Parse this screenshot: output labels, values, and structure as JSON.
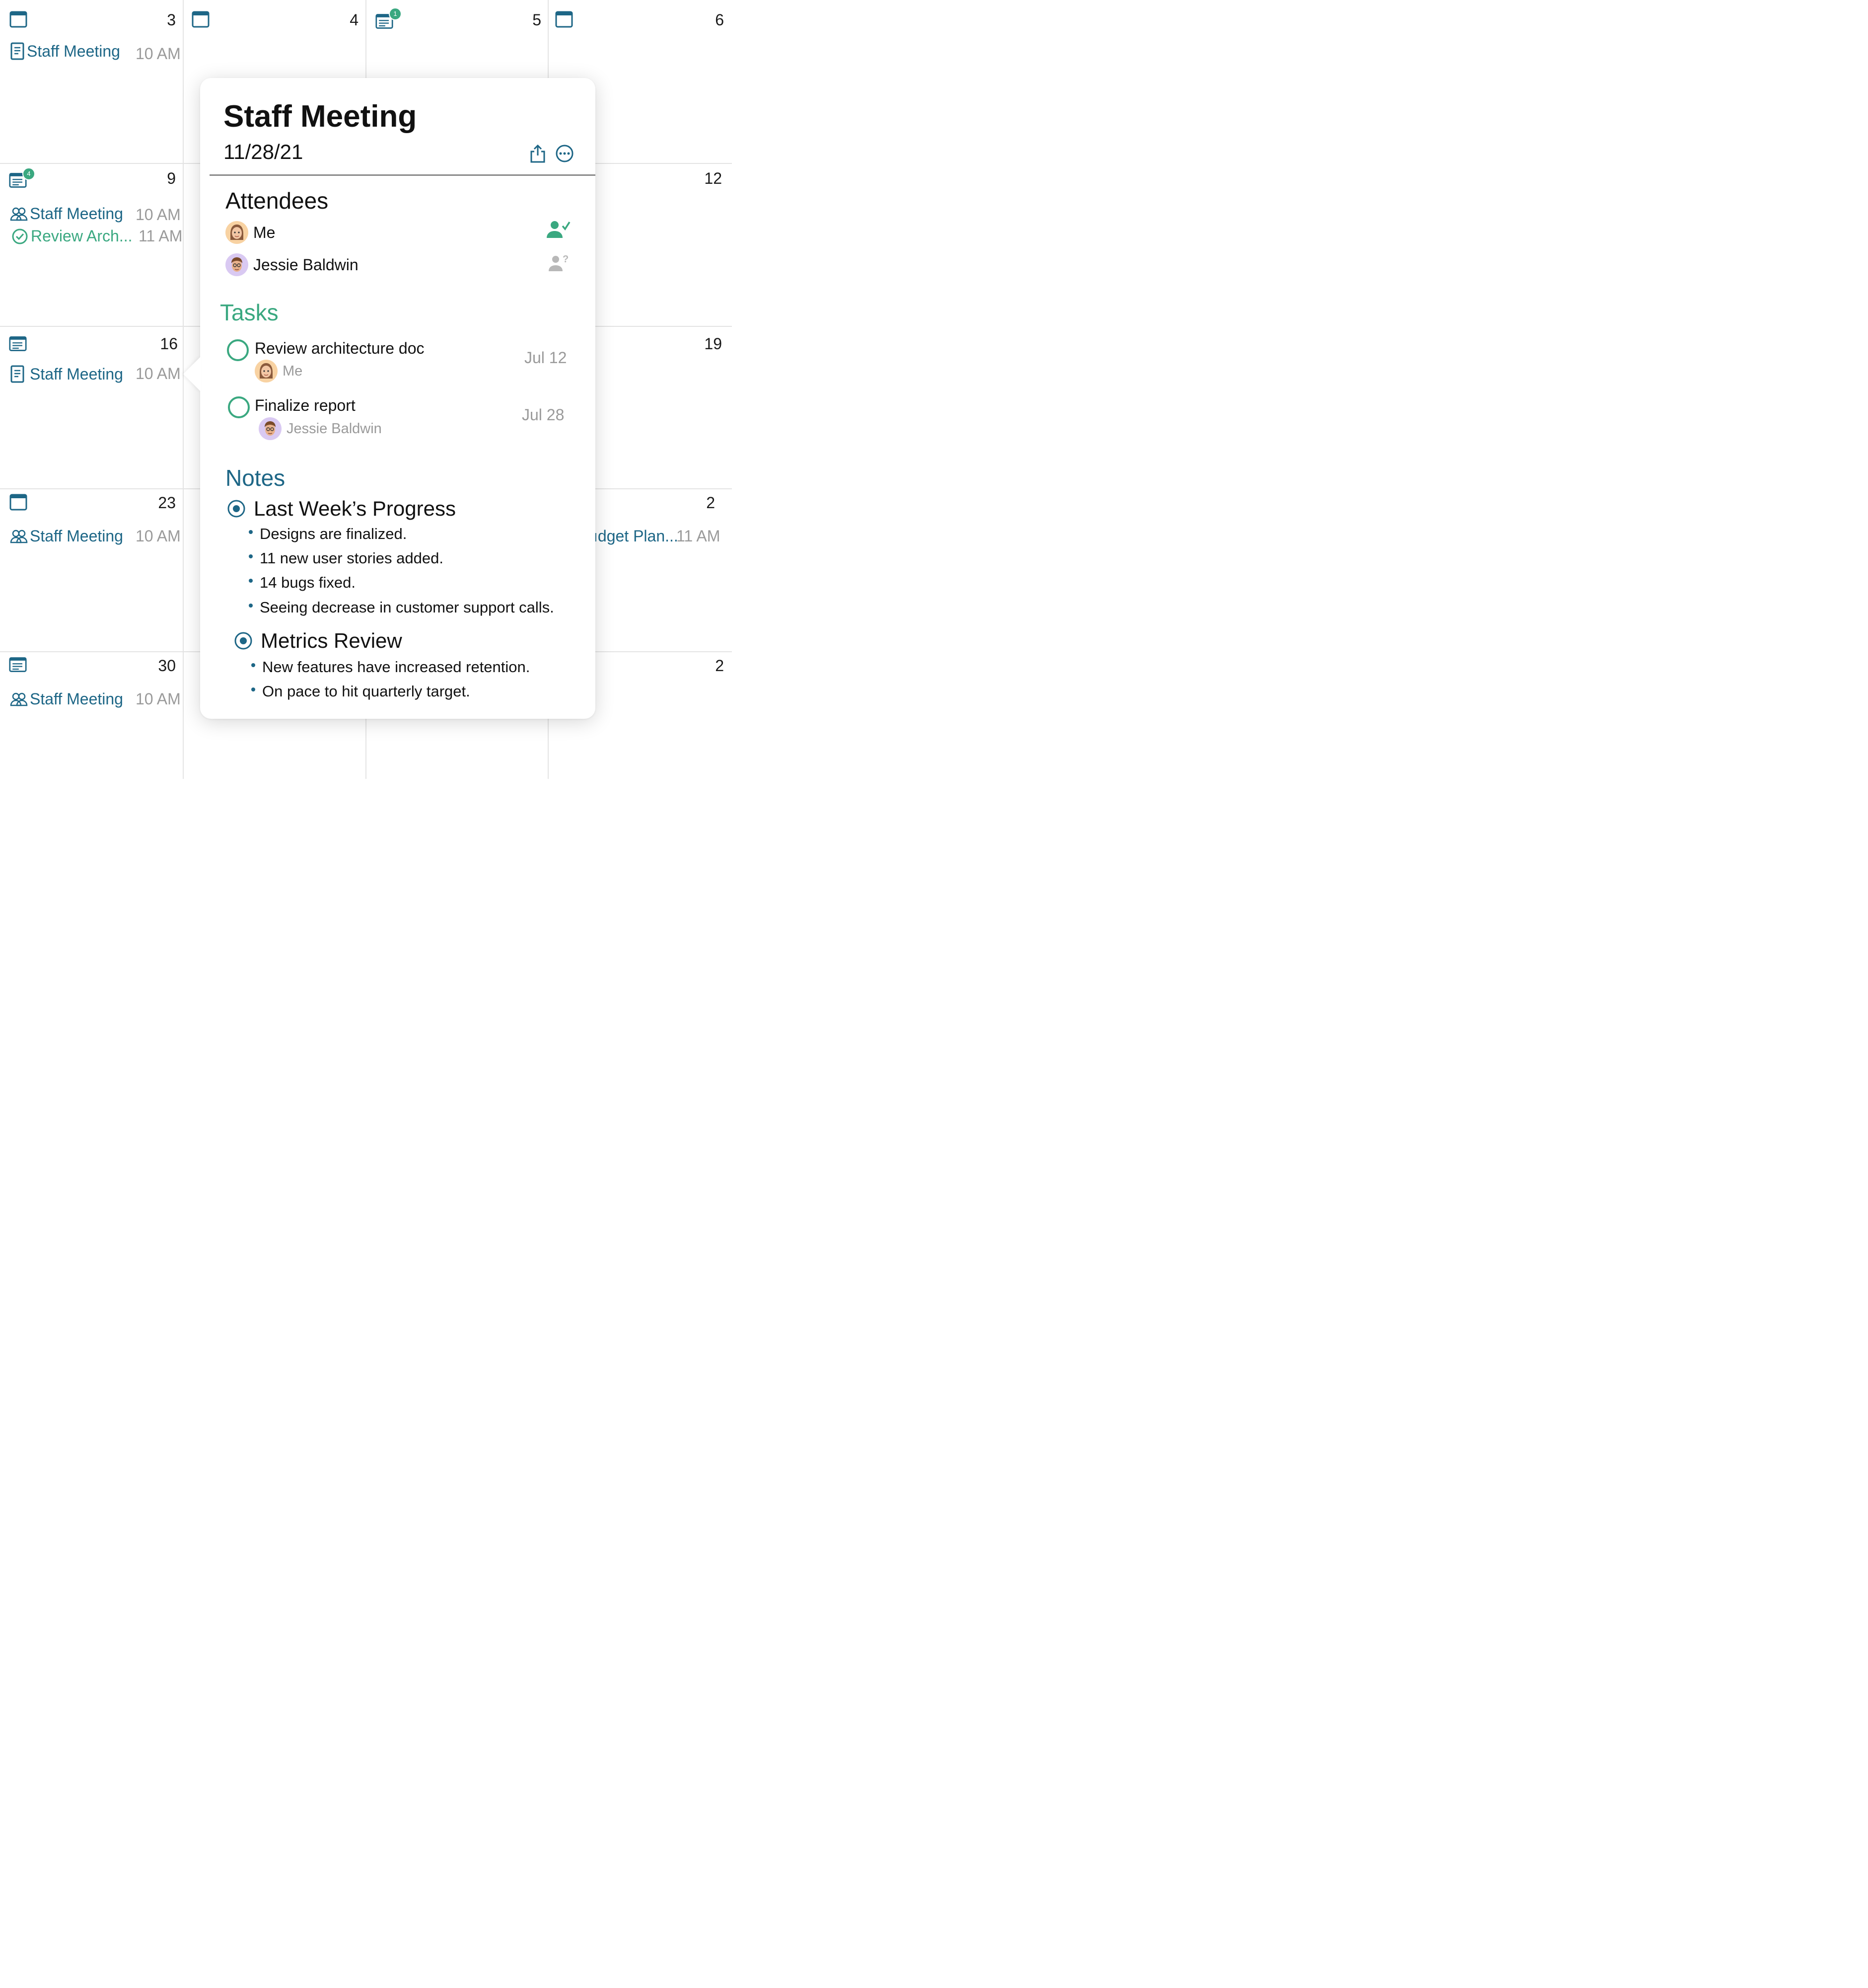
{
  "calendar": {
    "days": {
      "d3": "3",
      "d4": "4",
      "d5": "5",
      "d6": "6",
      "d9": "9",
      "d12": "12",
      "d16": "16",
      "d19": "19",
      "d23": "23",
      "d2a": "2",
      "d30": "30",
      "d2b": "2"
    },
    "badges": {
      "day5": "1",
      "day9": "4"
    },
    "events": {
      "e3": {
        "title": "Staff Meeting",
        "time": "10 AM"
      },
      "e9a": {
        "title": "Staff Meeting",
        "time": "10 AM"
      },
      "e9b": {
        "title": "Review Arch...",
        "time": "11 AM"
      },
      "e16": {
        "title": "Staff Meeting",
        "time": "10 AM"
      },
      "e23": {
        "title": "Staff Meeting",
        "time": "10 AM"
      },
      "e30": {
        "title": "Staff Meeting",
        "time": "10 AM"
      },
      "e2": {
        "title": "ıdget Plan...",
        "time": "11 AM"
      }
    }
  },
  "popover": {
    "title": "Staff Meeting",
    "date": "11/28/21",
    "attendees_heading": "Attendees",
    "attendees": [
      {
        "name": "Me",
        "status": "accepted",
        "avatar": "memoji-woman"
      },
      {
        "name": "Jessie Baldwin",
        "status": "pending",
        "avatar": "memoji-man"
      }
    ],
    "tasks_heading": "Tasks",
    "tasks": [
      {
        "title": "Review architecture doc",
        "assignee": "Me",
        "due": "Jul 12"
      },
      {
        "title": "Finalize report",
        "assignee": "Jessie Baldwin",
        "due": "Jul 28"
      }
    ],
    "notes_heading": "Notes",
    "notes": [
      {
        "heading": "Last Week’s Progress",
        "bullets": [
          "Designs are finalized.",
          "11 new user stories added.",
          "14 bugs fixed.",
          "Seeing decrease in customer support calls."
        ]
      },
      {
        "heading": "Metrics Review",
        "bullets": [
          "New features have increased retention.",
          "On pace to hit quarterly target."
        ]
      }
    ]
  },
  "colors": {
    "accent_blue": "#1d6686",
    "accent_green": "#3aa880",
    "muted_gray": "#9a9a9a"
  }
}
